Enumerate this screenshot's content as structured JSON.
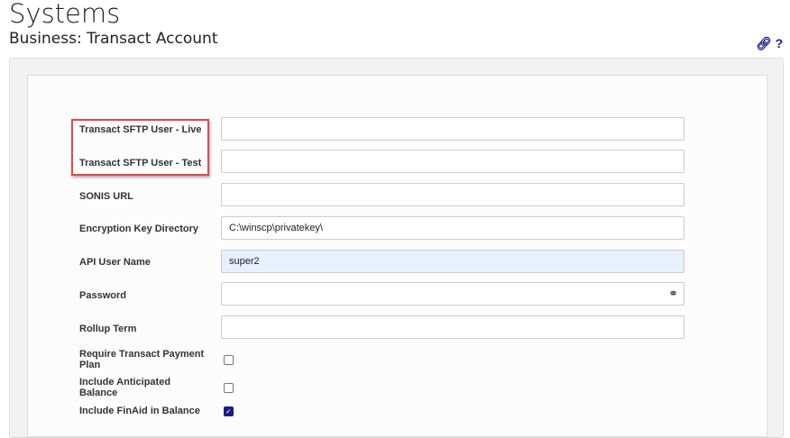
{
  "header": {
    "title": "Systems",
    "subtitle": "Business: Transact Account"
  },
  "icons": {
    "link": "link-icon",
    "help": "?"
  },
  "fields": [
    {
      "label": "Transact SFTP User - Live",
      "value": ""
    },
    {
      "label": "Transact SFTP User - Test",
      "value": ""
    },
    {
      "label": "SONIS URL",
      "value": ""
    },
    {
      "label": "Encryption Key Directory",
      "value": "C:\\winscp\\privatekey\\"
    },
    {
      "label": "API User Name",
      "value": "super2"
    },
    {
      "label": "Password",
      "value": ""
    },
    {
      "label": "Rollup Term",
      "value": ""
    }
  ],
  "checkboxes": [
    {
      "label": "Require Transact Payment Plan",
      "checked": false
    },
    {
      "label": "Include Anticipated Balance",
      "checked": false
    },
    {
      "label": "Include FinAid in Balance",
      "checked": true
    }
  ],
  "colors": {
    "highlight": "#e04848",
    "autofill": "#e8f0fe",
    "accent": "#1c1c80"
  }
}
